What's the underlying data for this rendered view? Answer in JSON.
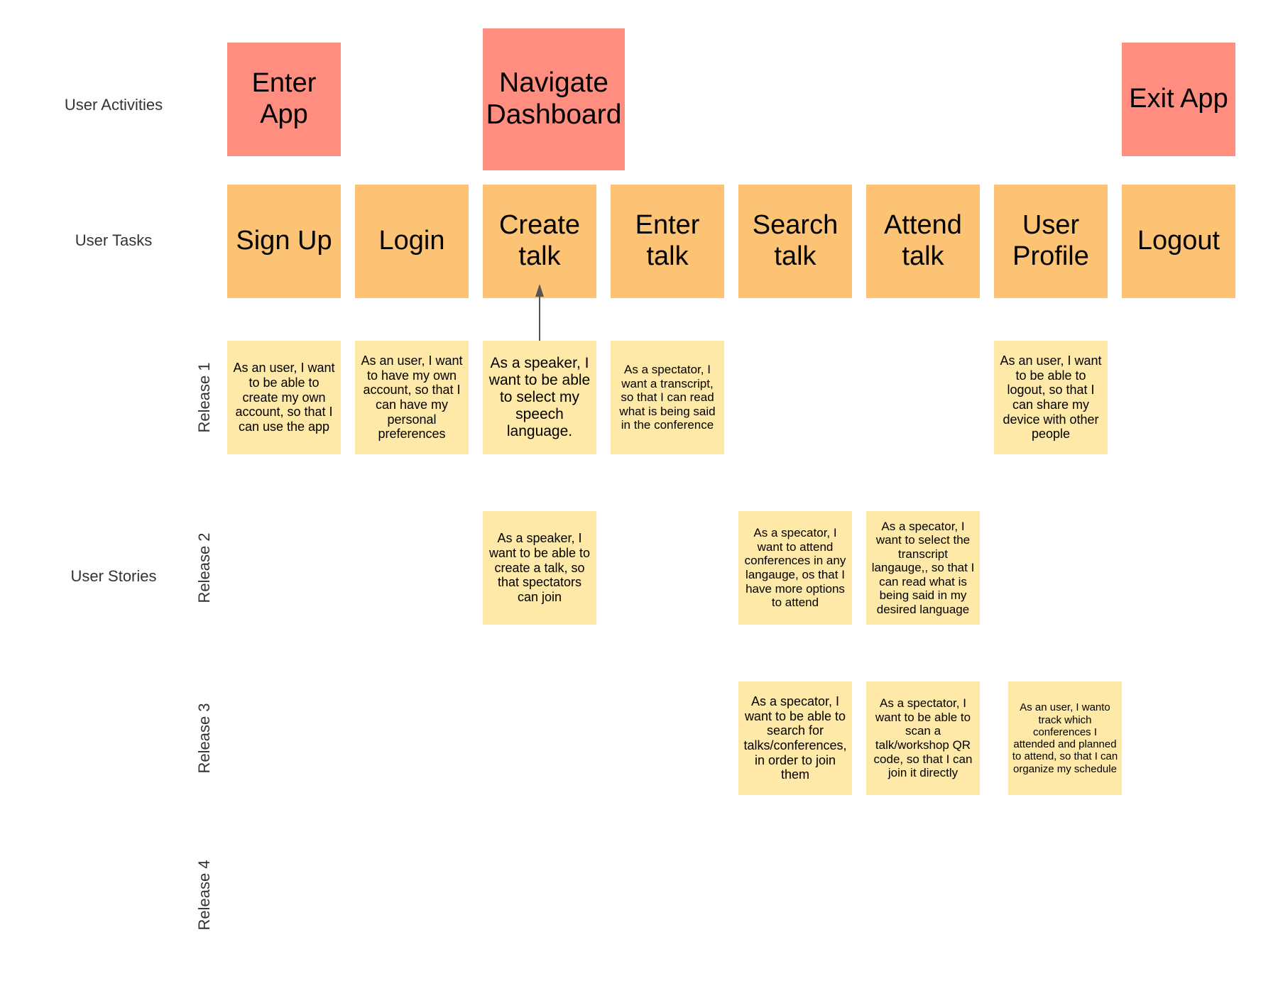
{
  "colors": {
    "activity": "#ff8d80",
    "task": "#fdc374",
    "story": "#ffe9a8",
    "label_text": "#333333",
    "connector": "#555555"
  },
  "row_labels": {
    "activities": "User Activities",
    "tasks": "User Tasks",
    "stories": "User Stories"
  },
  "releases": [
    "Release 1",
    "Release 2",
    "Release 3",
    "Release 4"
  ],
  "activities": [
    {
      "label": "Enter App",
      "column": 0
    },
    {
      "label": "Navigate Dashboard",
      "column": 2
    },
    {
      "label": "Exit App",
      "column": 7
    }
  ],
  "tasks": [
    "Sign Up",
    "Login",
    "Create talk",
    "Enter talk",
    "Search talk",
    "Attend talk",
    "User Profile",
    "Logout"
  ],
  "stories": {
    "release_1": [
      {
        "task": "Sign Up",
        "text": "As an user, I want to be able to create my own account, so that I can use the app"
      },
      {
        "task": "Login",
        "text": "As an user, I want to have my own account, so that I can have my personal preferences"
      },
      {
        "task": "Create talk",
        "text": "As a speaker, I want to be able to select my speech language."
      },
      {
        "task": "Enter talk",
        "text": "As a spectator, I want a transcript, so that I can read what is being said in the conference"
      },
      {
        "task": "User Profile",
        "text": "As an user, I want to be able to logout, so that I can share my device with other people"
      }
    ],
    "release_2": [
      {
        "task": "Create talk",
        "text": "As a speaker, I want to be able to create a talk, so that spectators can join"
      },
      {
        "task": "Search talk",
        "text": "As a specator, I want to attend conferences in any langauge, os that I have more options to attend"
      },
      {
        "task": "Attend talk",
        "text": "As a specator, I want to select the transcript langauge,, so that I can read what is being said in my desired language"
      }
    ],
    "release_3": [
      {
        "task": "Search talk",
        "text": "As a specator, I want to be able to search for talks/conferences, in order to join them"
      },
      {
        "task": "Attend talk",
        "text": "As a spectator, I want to be able to scan a talk/workshop QR code, so that I can join it directly"
      },
      {
        "task": "User Profile",
        "text": "As an user, I wanto track which conferences I attended and planned to attend, so that I can organize my schedule"
      }
    ],
    "release_4": []
  },
  "connectors": [
    {
      "from": "story: As a speaker, I want to be able to select my speech language.",
      "to": "task: Create talk"
    }
  ]
}
